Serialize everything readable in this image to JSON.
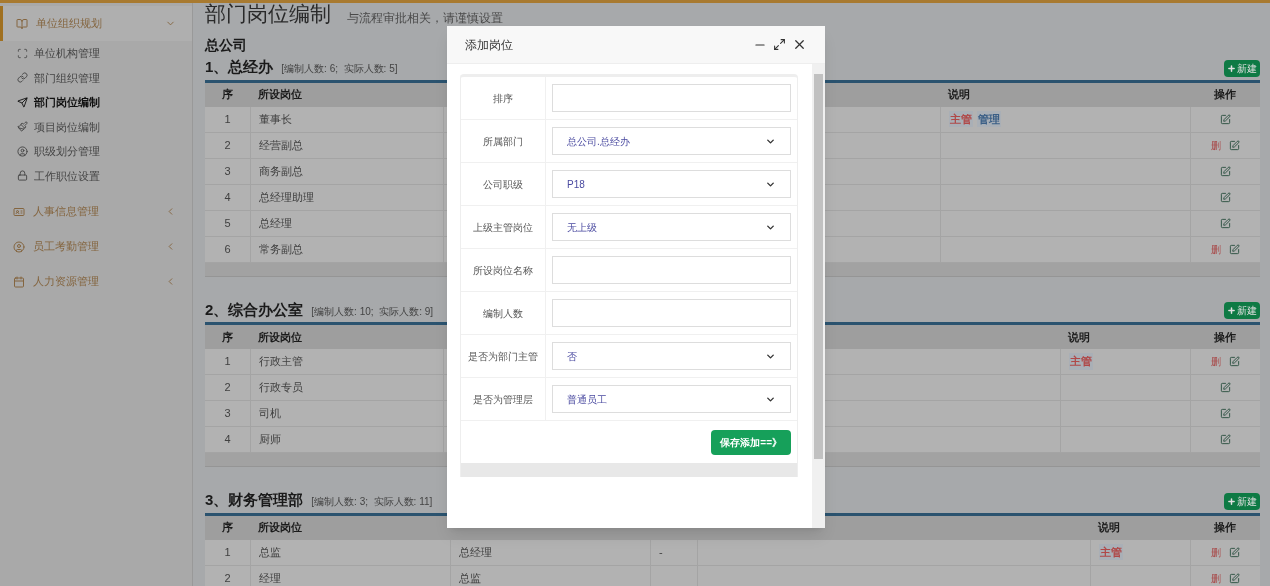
{
  "sidebar": {
    "groups": [
      {
        "label": "单位组织规划",
        "expanded": true,
        "items": [
          {
            "label": "单位机构管理",
            "selected": false
          },
          {
            "label": "部门组织管理",
            "selected": false
          },
          {
            "label": "部门岗位编制",
            "selected": true
          },
          {
            "label": "项目岗位编制",
            "selected": false
          },
          {
            "label": "职级划分管理",
            "selected": false
          },
          {
            "label": "工作职位设置",
            "selected": false
          }
        ]
      },
      {
        "label": "人事信息管理",
        "expanded": false
      },
      {
        "label": "员工考勤管理",
        "expanded": false
      },
      {
        "label": "人力资源管理",
        "expanded": false
      }
    ]
  },
  "page": {
    "title": "部门岗位编制",
    "subtitle": "与流程审批相关，请谨慎设置",
    "company": "总公司"
  },
  "tables": [
    {
      "title": "1、总经办",
      "counts": "[编制人数: 6;  实际人数: 5]",
      "new_label": "新建",
      "columns": [
        {
          "kind": "seq",
          "label": "序"
        },
        {
          "kind": "post",
          "label": "所设岗位"
        },
        {
          "kind": "column_3"
        },
        {
          "kind": "note",
          "label": "说明"
        },
        {
          "kind": "ops",
          "label": "操作"
        }
      ],
      "rows": [
        {
          "cells": [
            "1",
            "董事长"
          ],
          "tags": [
            {
              "text": "主管",
              "color": "#b04848"
            },
            {
              "text": "管理",
              "color": "#3b5f86"
            }
          ]
        },
        {
          "cells": [
            "2",
            "经营副总"
          ],
          "delete_label": "删"
        },
        {
          "cells": [
            "3",
            "商务副总"
          ]
        },
        {
          "cells": [
            "4",
            "总经理助理"
          ]
        },
        {
          "cells": [
            "5",
            "总经理"
          ]
        },
        {
          "cells": [
            "6",
            "常务副总"
          ],
          "delete_label": "删"
        }
      ]
    },
    {
      "title": "2、综合办公室",
      "counts": "[编制人数: 10;  实际人数: 9]",
      "new_label": "新建",
      "columns": [
        {
          "kind": "seq",
          "label": "序"
        },
        {
          "kind": "post",
          "label": "所设岗位"
        },
        {
          "kind": "column_3"
        },
        {
          "kind": "note",
          "label": "说明"
        },
        {
          "kind": "ops",
          "label": "操作"
        }
      ],
      "rows": [
        {
          "cells": [
            "1",
            "行政主管"
          ],
          "tags": [
            {
              "text": "主管",
              "color": "#b04848"
            }
          ],
          "delete_label": "删"
        },
        {
          "cells": [
            "2",
            "行政专员"
          ]
        },
        {
          "cells": [
            "3",
            "司机"
          ]
        },
        {
          "cells": [
            "4",
            "厨师"
          ]
        }
      ]
    },
    {
      "title": "3、财务管理部",
      "counts": "[编制人数: 3;  实际人数: 11]",
      "new_label": "新建",
      "columns": [
        {
          "kind": "seq",
          "label": "序"
        },
        {
          "kind": "post",
          "label": "所设岗位"
        },
        {
          "kind": "superior"
        },
        {
          "kind": "count"
        },
        {
          "kind": "staff"
        },
        {
          "kind": "note",
          "label": "说明"
        },
        {
          "kind": "ops",
          "label": "操作"
        }
      ],
      "rows": [
        {
          "cells": [
            "1",
            "总监",
            "总经理",
            "-"
          ],
          "tags": [
            {
              "text": "主管",
              "color": "#b04848"
            }
          ],
          "delete_label": "删"
        },
        {
          "cells": [
            "2",
            "经理",
            "总监"
          ],
          "delete_label": "删"
        }
      ]
    }
  ],
  "dialog": {
    "title": "添加岗位",
    "fields": [
      {
        "label": "排序",
        "kind": "input"
      },
      {
        "label": "所属部门",
        "kind": "select",
        "value": "总公司.总经办"
      },
      {
        "label": "公司职级",
        "kind": "select",
        "value": "P18"
      },
      {
        "label": "上级主管岗位",
        "kind": "select",
        "value": "无上级"
      },
      {
        "label": "所设岗位名称",
        "kind": "input"
      },
      {
        "label": "编制人数",
        "kind": "input"
      },
      {
        "label": "是否为部门主管",
        "kind": "select",
        "value": "否"
      },
      {
        "label": "是否为管理层",
        "kind": "select",
        "value": "普通员工"
      }
    ],
    "submit": "保存添加==》"
  }
}
